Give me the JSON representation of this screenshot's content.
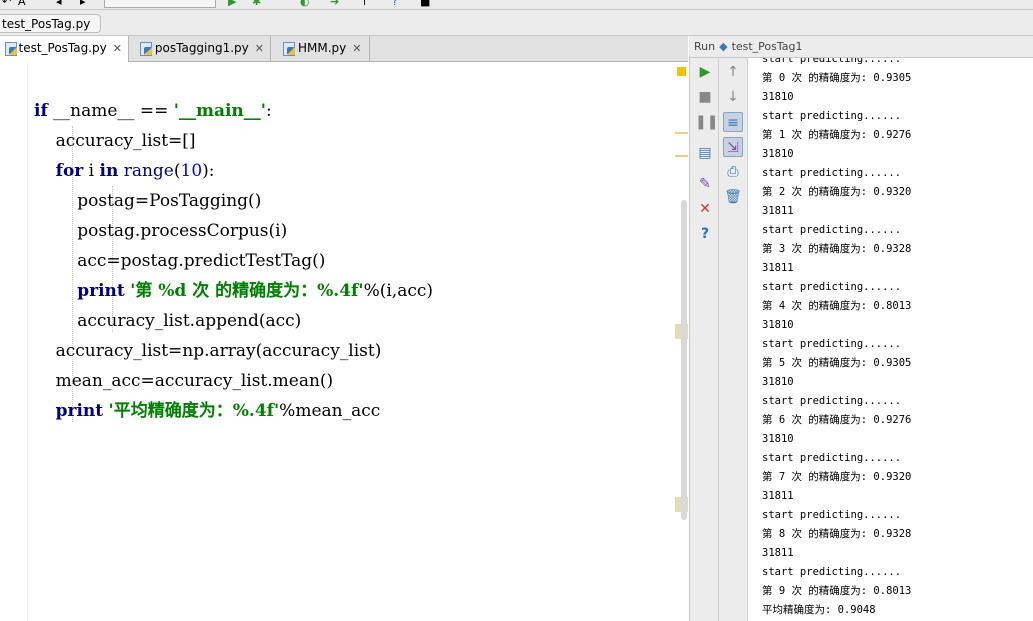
{
  "breadcrumb": "test_PosTag.py",
  "tabs": [
    {
      "label": "test_PosTag.py",
      "active": true
    },
    {
      "label": "posTagging1.py"
    },
    {
      "label": "HMM.py"
    }
  ],
  "code": {
    "lines": [
      [
        {
          "t": "if",
          "c": "kw"
        },
        {
          "t": " __name__ == "
        },
        {
          "t": "'__main__'",
          "c": "str"
        },
        {
          "t": ":"
        }
      ],
      [
        {
          "t": "    accuracy_list=[]"
        }
      ],
      [
        {
          "t": "    "
        },
        {
          "t": "for",
          "c": "kw"
        },
        {
          "t": " i "
        },
        {
          "t": "in",
          "c": "kw"
        },
        {
          "t": " "
        },
        {
          "t": "range",
          "c": "kw2"
        },
        {
          "t": "("
        },
        {
          "t": "10",
          "c": "num"
        },
        {
          "t": "):"
        }
      ],
      [
        {
          "t": "        postag=PosTagging()"
        }
      ],
      [
        {
          "t": "        postag.processCorpus(i)"
        }
      ],
      [
        {
          "t": "        acc=postag.predictTestTag()"
        }
      ],
      [
        {
          "t": "        "
        },
        {
          "t": "print",
          "c": "kw"
        },
        {
          "t": " "
        },
        {
          "t": "'第 %d 次 的精确度为：%.4f'",
          "c": "str"
        },
        {
          "t": "%(i,acc)"
        }
      ],
      [
        {
          "t": "        accuracy_list.append(acc)"
        }
      ],
      [
        {
          "t": "    accuracy_list=np.array(accuracy_list)"
        }
      ],
      [
        {
          "t": "    mean_acc=accuracy_list.mean()"
        }
      ],
      [
        {
          "t": "    "
        },
        {
          "t": "print",
          "c": "kw"
        },
        {
          "t": " "
        },
        {
          "t": "'平均精确度为：%.4f'",
          "c": "str"
        },
        {
          "t": "%mean_acc"
        }
      ]
    ]
  },
  "run": {
    "label": "Run",
    "config": "test_PosTag1"
  },
  "console": {
    "top_partial": "start predicting......",
    "lines": [
      "第 0 次 的精确度为: 0.9305",
      "31810",
      "start predicting......",
      "第 1 次 的精确度为: 0.9276",
      "31810",
      "start predicting......",
      "第 2 次 的精确度为: 0.9320",
      "31811",
      "start predicting......",
      "第 3 次 的精确度为: 0.9328",
      "31811",
      "start predicting......",
      "第 4 次 的精确度为: 0.8013",
      "31810",
      "start predicting......",
      "第 5 次 的精确度为: 0.9305",
      "31810",
      "start predicting......",
      "第 6 次 的精确度为: 0.9276",
      "31810",
      "start predicting......",
      "第 7 次 的精确度为: 0.9320",
      "31811",
      "start predicting......",
      "第 8 次 的精确度为: 0.9328",
      "31811",
      "start predicting......",
      "第 9 次 的精确度为: 0.8013",
      "平均精确度为: 0.9048"
    ]
  },
  "colors": {
    "keyword": "#000080",
    "string": "#008000",
    "number": "#0000ff",
    "caret_line": "#fffae3"
  }
}
